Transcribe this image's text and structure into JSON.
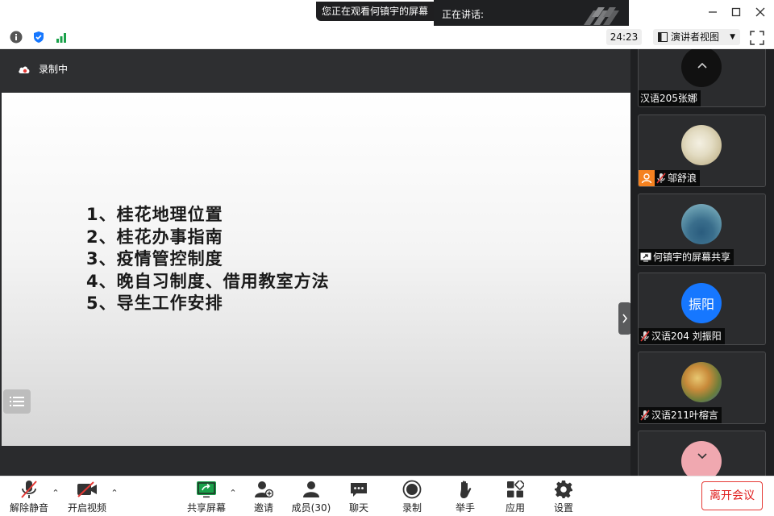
{
  "topbar": {
    "viewing_text": "您正在观看何镇宇的屏幕",
    "speaking_label": "正在讲话:"
  },
  "infobar": {
    "timer": "24:23",
    "view_mode": "演讲者视图"
  },
  "recording": {
    "status": "录制中"
  },
  "slide": {
    "items": [
      "1、桂花地理位置",
      "2、桂花办事指南",
      "3、疫情管控制度",
      "4、晚自习制度、借用教室方法",
      "5、导生工作安排"
    ]
  },
  "gallery": {
    "participants": [
      {
        "name": "汉语205张娜",
        "muted": false
      },
      {
        "name": "邬舒浪",
        "muted": true
      },
      {
        "name": "何镇宇的屏幕共享",
        "muted": false
      },
      {
        "name": "汉语204 刘振阳",
        "muted": true,
        "avatar_text": "振阳"
      },
      {
        "name": "汉语211叶榕言",
        "muted": true
      }
    ]
  },
  "toolbar": {
    "unmute": "解除静音",
    "start_video": "开启视频",
    "share_screen": "共享屏幕",
    "invite": "邀请",
    "members": "成员(30)",
    "chat": "聊天",
    "record": "录制",
    "raise_hand": "举手",
    "apps": "应用",
    "settings": "设置",
    "leave": "离开会议"
  },
  "colors": {
    "accent_blue": "#1677ff",
    "leave_red": "#e02020",
    "share_green": "#1aa14a"
  }
}
